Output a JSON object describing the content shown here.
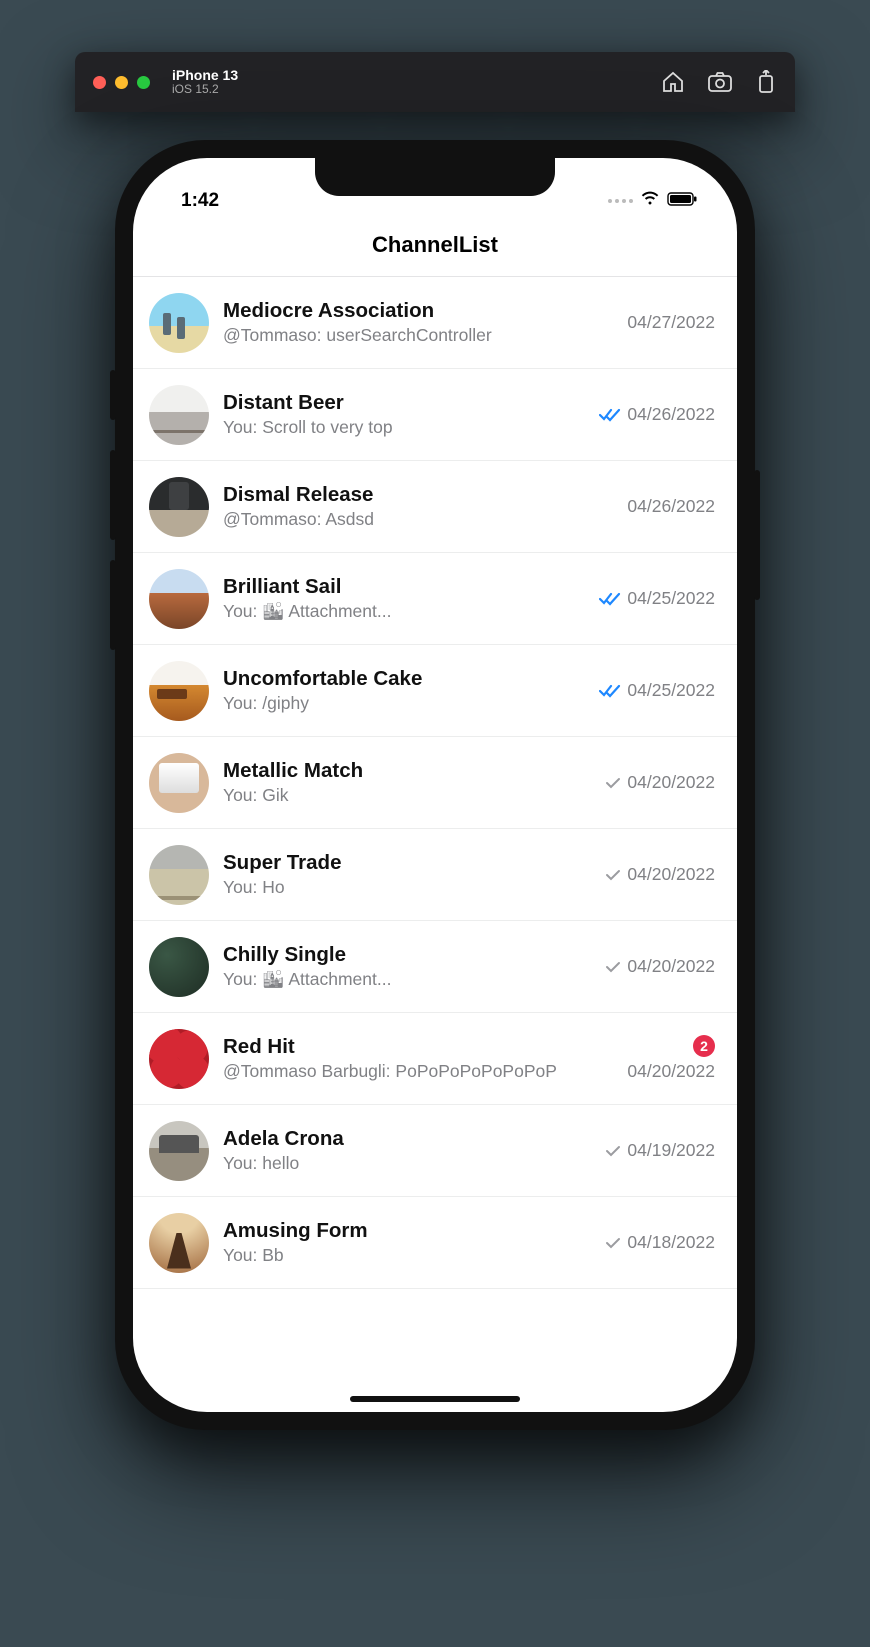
{
  "simulator": {
    "device": "iPhone 13",
    "os": "iOS 15.2"
  },
  "statusBar": {
    "time": "1:42"
  },
  "header": {
    "title": "ChannelList"
  },
  "channels": [
    {
      "title": "Mediocre Association",
      "subtitle": "@Tommaso: userSearchController",
      "date": "04/27/2022",
      "status": "none",
      "badge": null
    },
    {
      "title": "Distant Beer",
      "subtitle": "You: Scroll to very top",
      "date": "04/26/2022",
      "status": "read",
      "badge": null
    },
    {
      "title": "Dismal Release",
      "subtitle": "@Tommaso: Asdsd",
      "date": "04/26/2022",
      "status": "none",
      "badge": null
    },
    {
      "title": "Brilliant Sail",
      "subtitle": "You: 🏙 Attachment...",
      "date": "04/25/2022",
      "status": "read",
      "badge": null
    },
    {
      "title": "Uncomfortable Cake",
      "subtitle": "You: /giphy",
      "date": "04/25/2022",
      "status": "read",
      "badge": null
    },
    {
      "title": "Metallic Match",
      "subtitle": "You: Gik",
      "date": "04/20/2022",
      "status": "sent",
      "badge": null
    },
    {
      "title": "Super Trade",
      "subtitle": "You: Ho",
      "date": "04/20/2022",
      "status": "sent",
      "badge": null
    },
    {
      "title": "Chilly Single",
      "subtitle": "You: 🏙 Attachment...",
      "date": "04/20/2022",
      "status": "sent",
      "badge": null
    },
    {
      "title": "Red Hit",
      "subtitle": "@Tommaso Barbugli: PoPoPoPoPoPoPoP",
      "date": "04/20/2022",
      "status": "none",
      "badge": "2"
    },
    {
      "title": "Adela Crona",
      "subtitle": "You: hello",
      "date": "04/19/2022",
      "status": "sent",
      "badge": null
    },
    {
      "title": "Amusing Form",
      "subtitle": "You: Bb",
      "date": "04/18/2022",
      "status": "sent",
      "badge": null
    }
  ]
}
